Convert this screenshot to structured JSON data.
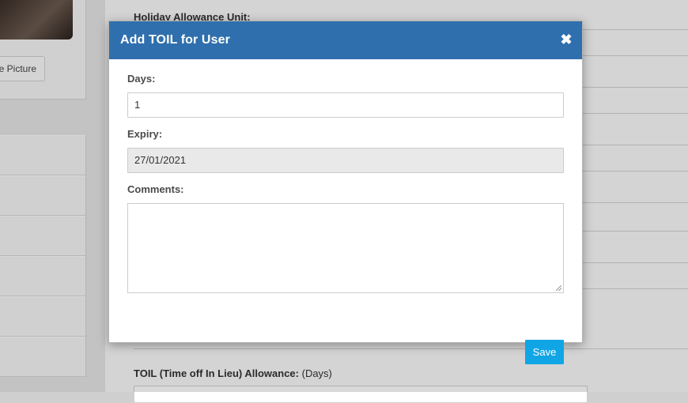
{
  "background": {
    "change_picture_label": "e Picture",
    "holiday_allowance_label": "Holiday Allowance Unit:",
    "toil_allowance_label": "TOIL (Time off In Lieu) Allowance:",
    "toil_allowance_unit": "(Days)"
  },
  "modal": {
    "title": "Add TOIL for User",
    "close_icon": "close-icon",
    "fields": {
      "days": {
        "label": "Days:",
        "value": "1"
      },
      "expiry": {
        "label": "Expiry:",
        "value": "27/01/2021"
      },
      "comments": {
        "label": "Comments:",
        "value": ""
      }
    },
    "save_label": "Save"
  },
  "colors": {
    "header": "#2f6fad",
    "save_button": "#10a5e5"
  }
}
